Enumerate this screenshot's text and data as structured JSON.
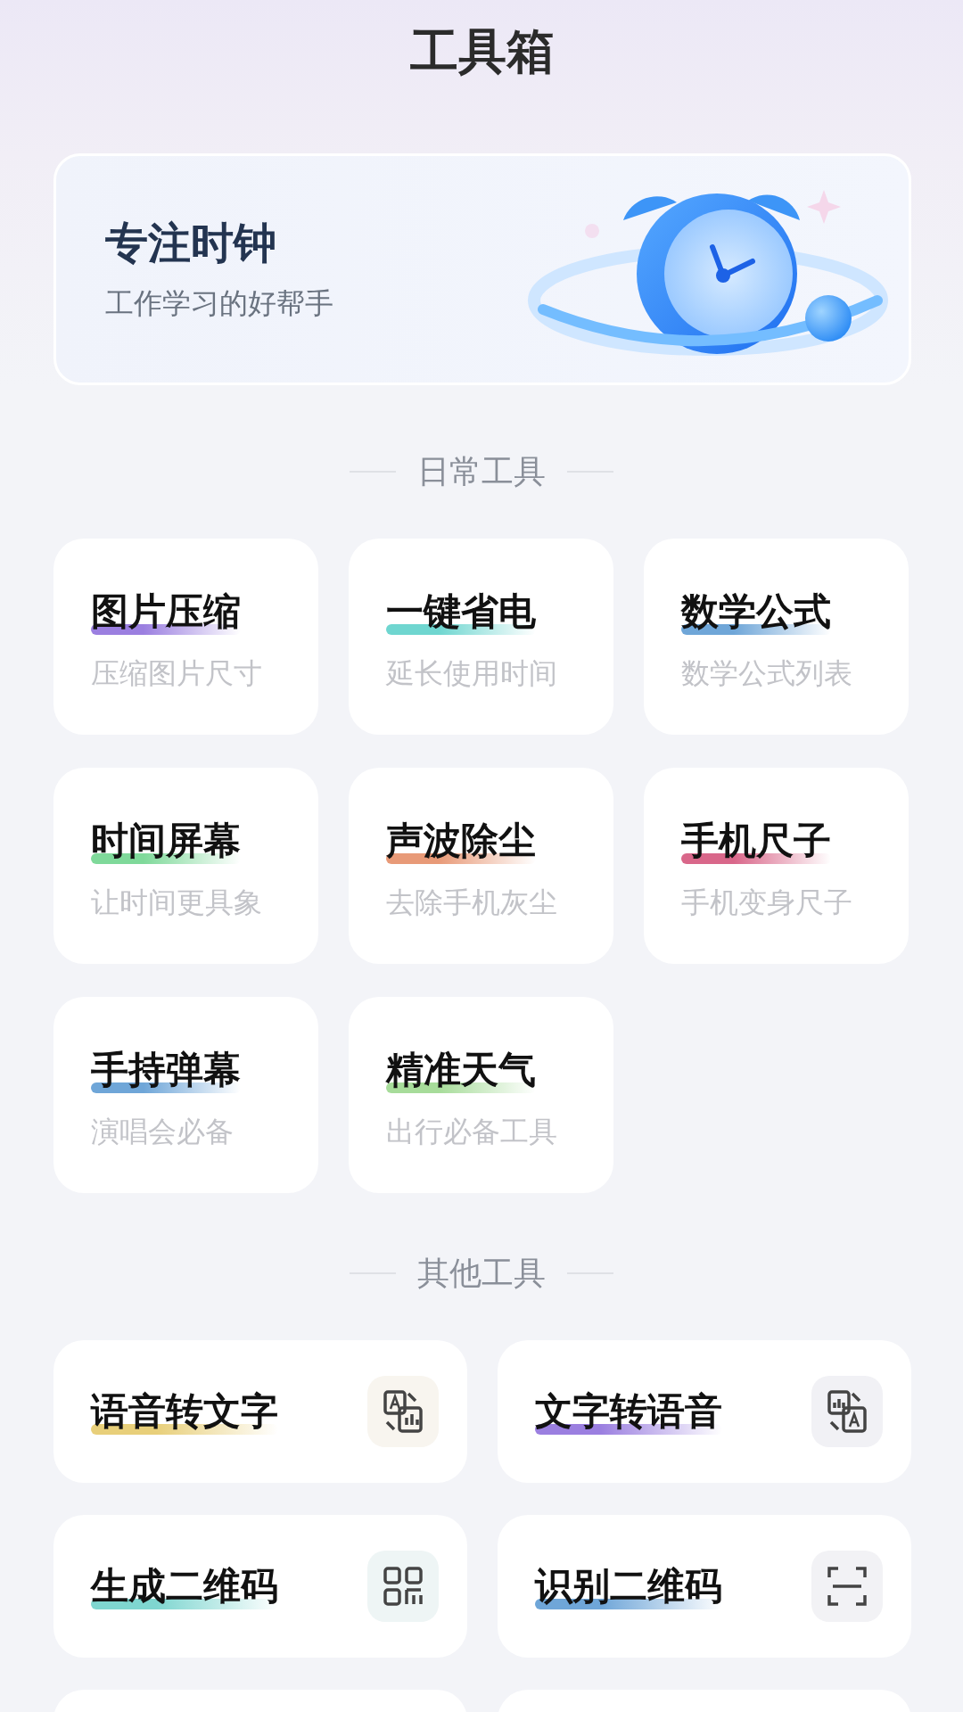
{
  "title": "工具箱",
  "banner": {
    "title": "专注时钟",
    "subtitle": "工作学习的好帮手"
  },
  "daily_section": {
    "heading": "日常工具",
    "tools": [
      {
        "name": "图片压缩",
        "description": "压缩图片尺寸",
        "color": "#9b7fe0"
      },
      {
        "name": "一键省电",
        "description": "延长使用时间",
        "color": "#6fd6d0"
      },
      {
        "name": "数学公式",
        "description": "数学公式列表",
        "color": "#6fa6d8"
      },
      {
        "name": "时间屏幕",
        "description": "让时间更具象",
        "color": "#7fd99a"
      },
      {
        "name": "声波除尘",
        "description": "去除手机灰尘",
        "color": "#e89a78"
      },
      {
        "name": "手机尺子",
        "description": "手机变身尺子",
        "color": "#d9678a"
      },
      {
        "name": "手持弹幕",
        "description": "演唱会必备",
        "color": "#6fa6d8"
      },
      {
        "name": "精准天气",
        "description": "出行必备工具",
        "color": "#a7dc9a"
      }
    ]
  },
  "other_section": {
    "heading": "其他工具",
    "tools": [
      {
        "name": "语音转文字",
        "kind": "speech-to-text",
        "color": "#e8cf7a"
      },
      {
        "name": "文字转语音",
        "kind": "text-to-speech",
        "color": "#9b7fe0"
      },
      {
        "name": "生成二维码",
        "kind": "qr-code",
        "color": "#7fd6d0"
      },
      {
        "name": "识别二维码",
        "kind": "scan",
        "color": "#6fa6d8"
      }
    ]
  }
}
